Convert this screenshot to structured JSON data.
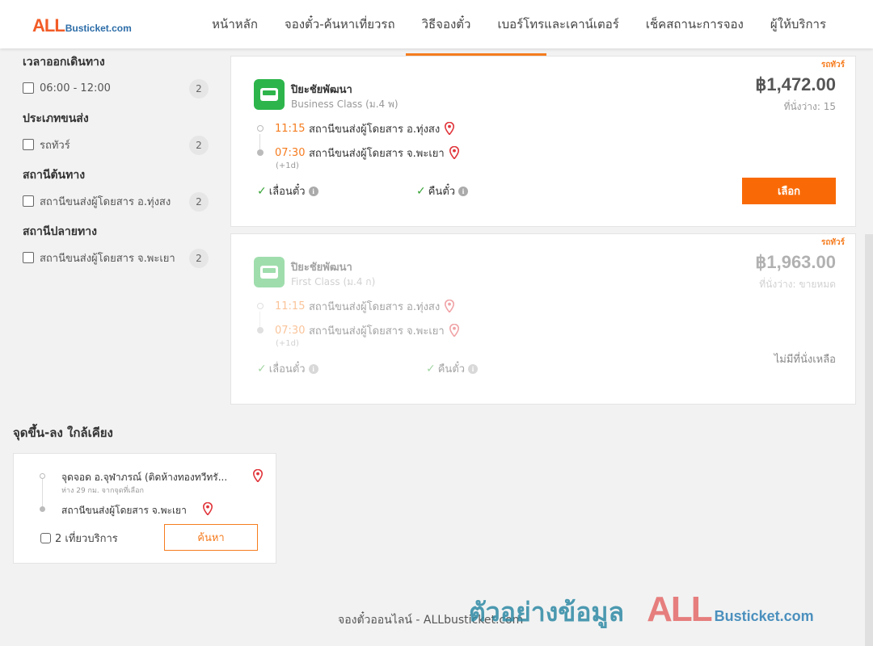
{
  "header": {
    "logo_all": "ALL",
    "logo_rest": "Busticket.com",
    "nav": [
      "หน้าหลัก",
      "จองตั๋ว-ค้นหาเที่ยวรถ",
      "วิธีจองตั๋ว",
      "เบอร์โทรและเคาน์เตอร์",
      "เช็คสถานะการจอง",
      "ผู้ให้บริการ"
    ]
  },
  "filters": {
    "departure_time": {
      "title": "เวลาออกเดินทาง",
      "option": "06:00 - 12:00",
      "count": "2"
    },
    "transport_type": {
      "title": "ประเภทขนส่ง",
      "option": "รถทัวร์",
      "count": "2"
    },
    "origin": {
      "title": "สถานีต้นทาง",
      "option": "สถานีขนส่งผู้โดยสาร อ.ทุ่งสง",
      "count": "2"
    },
    "destination": {
      "title": "สถานีปลายทาง",
      "option": "สถานีขนส่งผู้โดยสาร จ.พะเยา",
      "count": "2"
    }
  },
  "trips": [
    {
      "type_tag": "รถทัวร์",
      "company": "ปิยะชัยพัฒนา",
      "bus_class": "Business Class (ม.4 พ)",
      "price": "฿1,472.00",
      "seats": "ที่นั่งว่าง: 15",
      "depart_time": "11:15",
      "depart_station": "สถานีขนส่งผู้โดยสาร อ.ทุ่งสง",
      "arrive_time": "07:30",
      "arrive_station": "สถานีขนส่งผู้โดยสาร จ.พะเยา",
      "plus_day": "(+1d)",
      "feature_1": "เลื่อนตั๋ว",
      "feature_2": "คืนตั๋ว",
      "action": "เลือก"
    },
    {
      "type_tag": "รถทัวร์",
      "company": "ปิยะชัยพัฒนา",
      "bus_class": "First Class (ม.4 ก)",
      "price": "฿1,963.00",
      "seats": "ที่นั่งว่าง: ขายหมด",
      "depart_time": "11:15",
      "depart_station": "สถานีขนส่งผู้โดยสาร อ.ทุ่งสง",
      "arrive_time": "07:30",
      "arrive_station": "สถานีขนส่งผู้โดยสาร จ.พะเยา",
      "plus_day": "(+1d)",
      "feature_1": "เลื่อนตั๋ว",
      "feature_2": "คืนตั๋ว",
      "status": "ไม่มีที่นั่งเหลือ"
    }
  ],
  "nearby": {
    "title": "จุดขึ้น-ลง ใกล้เคียง",
    "from_station": "จุดจอด อ.จุฬาภรณ์ (ติดห้างทองทวีทรั...",
    "distance": "ห่าง 29 กม. จากจุดที่เลือก",
    "to_station": "สถานีขนส่งผู้โดยสาร จ.พะเยา",
    "trips": "2 เที่ยวบริการ",
    "search": "ค้นหา"
  },
  "footer": {
    "text": "จองตั๋วออนไลน์ - ALLbusticket.com"
  },
  "watermark": {
    "text": "ตัวอย่างข้อมูล",
    "all": "ALL",
    "rest": "Busticket.com"
  },
  "colors": {
    "accent": "#f96a07",
    "brand_orange": "#f25c27",
    "brand_blue": "#2d6da8",
    "check_green": "#35a335",
    "pin_red": "#e0353b"
  }
}
